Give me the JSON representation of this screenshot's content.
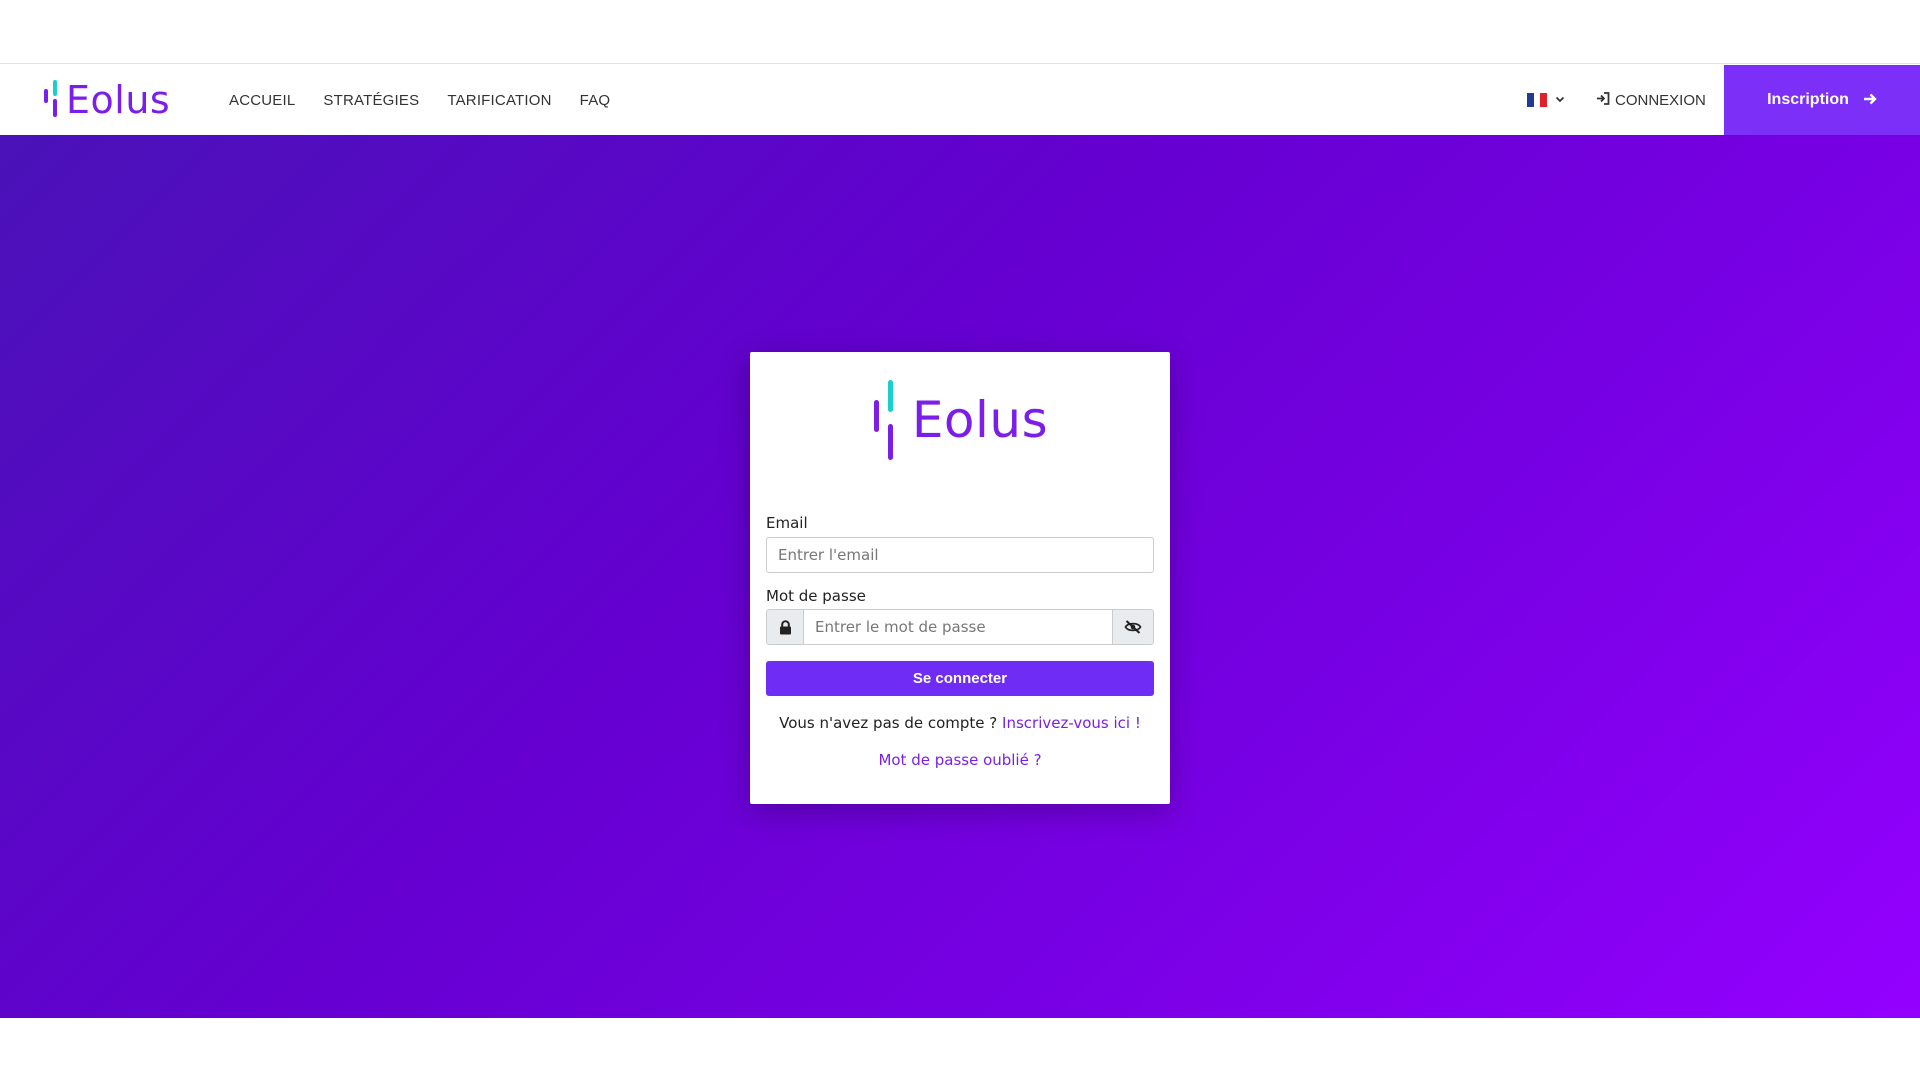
{
  "brand": {
    "name": "Eolus"
  },
  "nav": {
    "links": [
      "ACCUEIL",
      "STRATÉGIES",
      "TARIFICATION",
      "FAQ"
    ],
    "language": {
      "flag": "fr",
      "icon": "chevron-down-icon"
    },
    "login": {
      "label": "CONNEXION",
      "icon": "sign-in-icon"
    },
    "signup": {
      "label": "Inscription",
      "icon": "arrow-right-icon"
    }
  },
  "login_card": {
    "logo_text": "Eolus",
    "email": {
      "label": "Email",
      "placeholder": "Entrer l'email",
      "value": ""
    },
    "password": {
      "label": "Mot de passe",
      "placeholder": "Entrer le mot de passe",
      "value": "",
      "left_icon": "lock-icon",
      "right_icon": "eye-slash-icon"
    },
    "submit_label": "Se connecter",
    "no_account_text": "Vous n'avez pas de compte ?",
    "signup_link": "Inscrivez-vous ici !",
    "forgot_password": "Mot de passe oublié ?"
  },
  "colors": {
    "accent": "#7b2ff7",
    "brand_purple": "#7b1fe8",
    "brand_teal": "#18d0d0",
    "gradient_start": "#4a12b8",
    "gradient_end": "#9400ff"
  }
}
